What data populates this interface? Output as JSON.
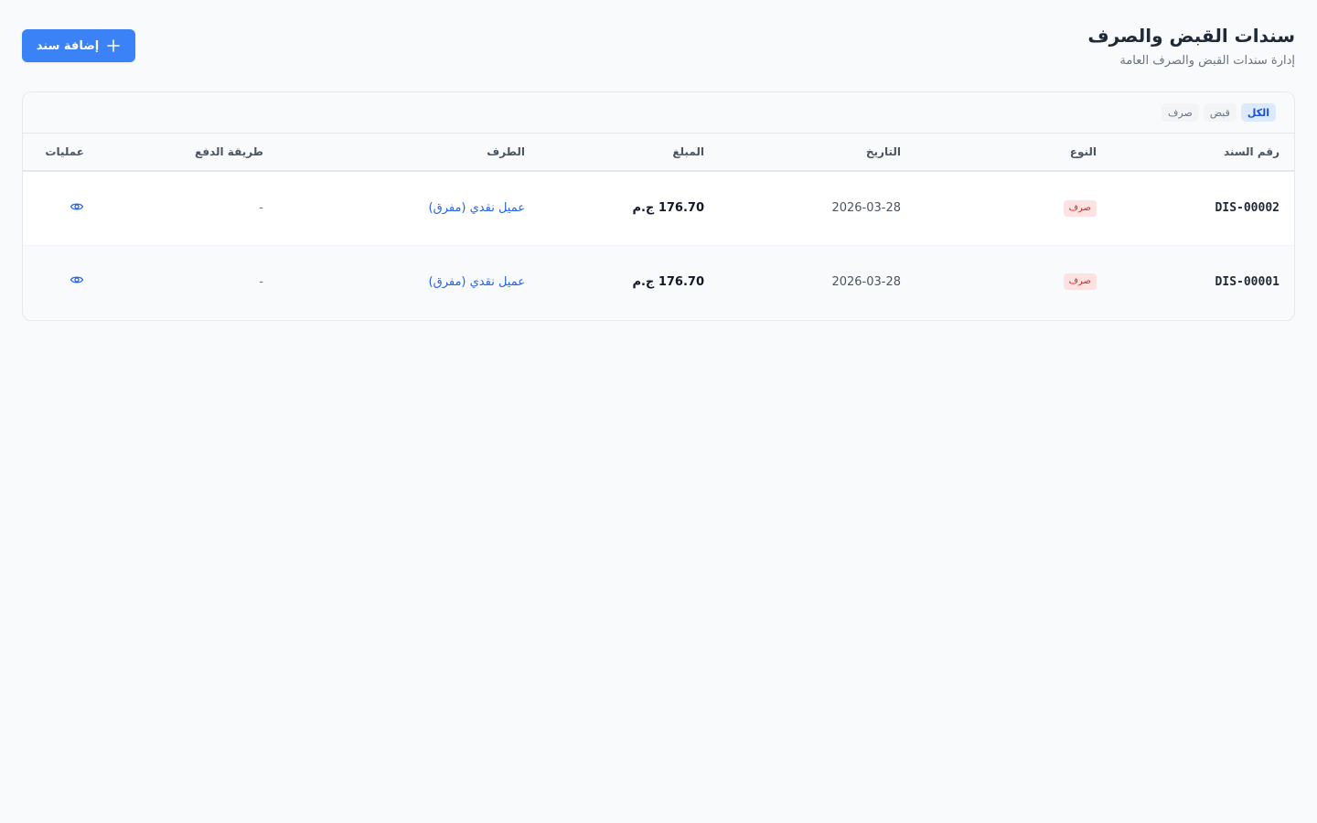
{
  "header": {
    "title": "سندات القبض والصرف",
    "subtitle": "إدارة سندات القبض والصرف العامة",
    "add_button_label": "إضافة سند"
  },
  "filters": [
    {
      "label": "الكل",
      "active": true
    },
    {
      "label": "قبض",
      "active": false
    },
    {
      "label": "صرف",
      "active": false
    }
  ],
  "table": {
    "columns": {
      "number": "رقم السند",
      "type": "النوع",
      "date": "التاريخ",
      "amount": "المبلغ",
      "party": "الطرف",
      "payment_method": "طريقة الدفع",
      "actions": "عمليات"
    },
    "rows": [
      {
        "number": "DIS-00002",
        "type": "صرف",
        "date": "2026-03-28",
        "amount": "176.70 ج.م",
        "party": "عميل نقدي (مفرق)",
        "payment_method": "-",
        "action_icon": "eye-icon"
      },
      {
        "number": "DIS-00001",
        "type": "صرف",
        "date": "2026-03-28",
        "amount": "176.70 ج.م",
        "party": "عميل نقدي (مفرق)",
        "payment_method": "-",
        "action_icon": "eye-icon"
      }
    ]
  },
  "colors": {
    "accent": "#3b82f6",
    "link": "#2563eb",
    "badge_bg": "#fee2e2",
    "badge_text": "#dc2626",
    "background": "#f8fafc"
  }
}
